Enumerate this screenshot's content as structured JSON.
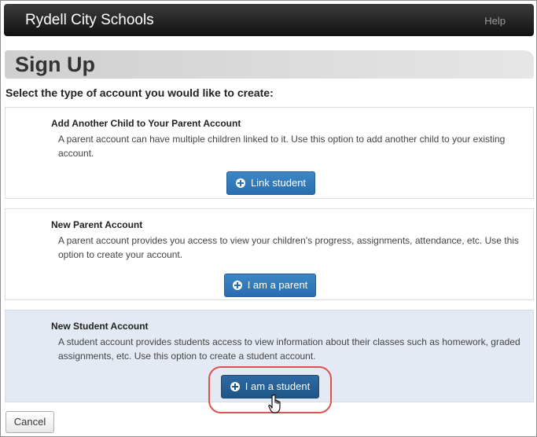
{
  "navbar": {
    "brand": "Rydell City Schools",
    "help_label": "Help"
  },
  "page": {
    "title": "Sign Up",
    "instruction": "Select the type of account you would like to create:"
  },
  "options": [
    {
      "title": "Add Another Child to Your Parent Account",
      "description": "A parent account can have multiple children linked to it. Use this option to add another child to your existing account.",
      "button_label": "Link student",
      "icon": "plus-circle-icon"
    },
    {
      "title": "New Parent Account",
      "description": "A parent account provides you access to view your children's progress, assignments, attendance, etc. Use this option to create your account.",
      "button_label": "I am a parent",
      "icon": "plus-circle-icon"
    },
    {
      "title": "New Student Account",
      "description": "A student account provides students access to view information about their classes such as homework, graded assignments, etc. Use this option to create a student account.",
      "button_label": "I am a student",
      "icon": "plus-circle-icon"
    }
  ],
  "footer": {
    "cancel_label": "Cancel"
  },
  "colors": {
    "primary_button": "#2a6db0",
    "highlight_panel": "#e4eaf3",
    "callout_ring": "#d9534f"
  }
}
